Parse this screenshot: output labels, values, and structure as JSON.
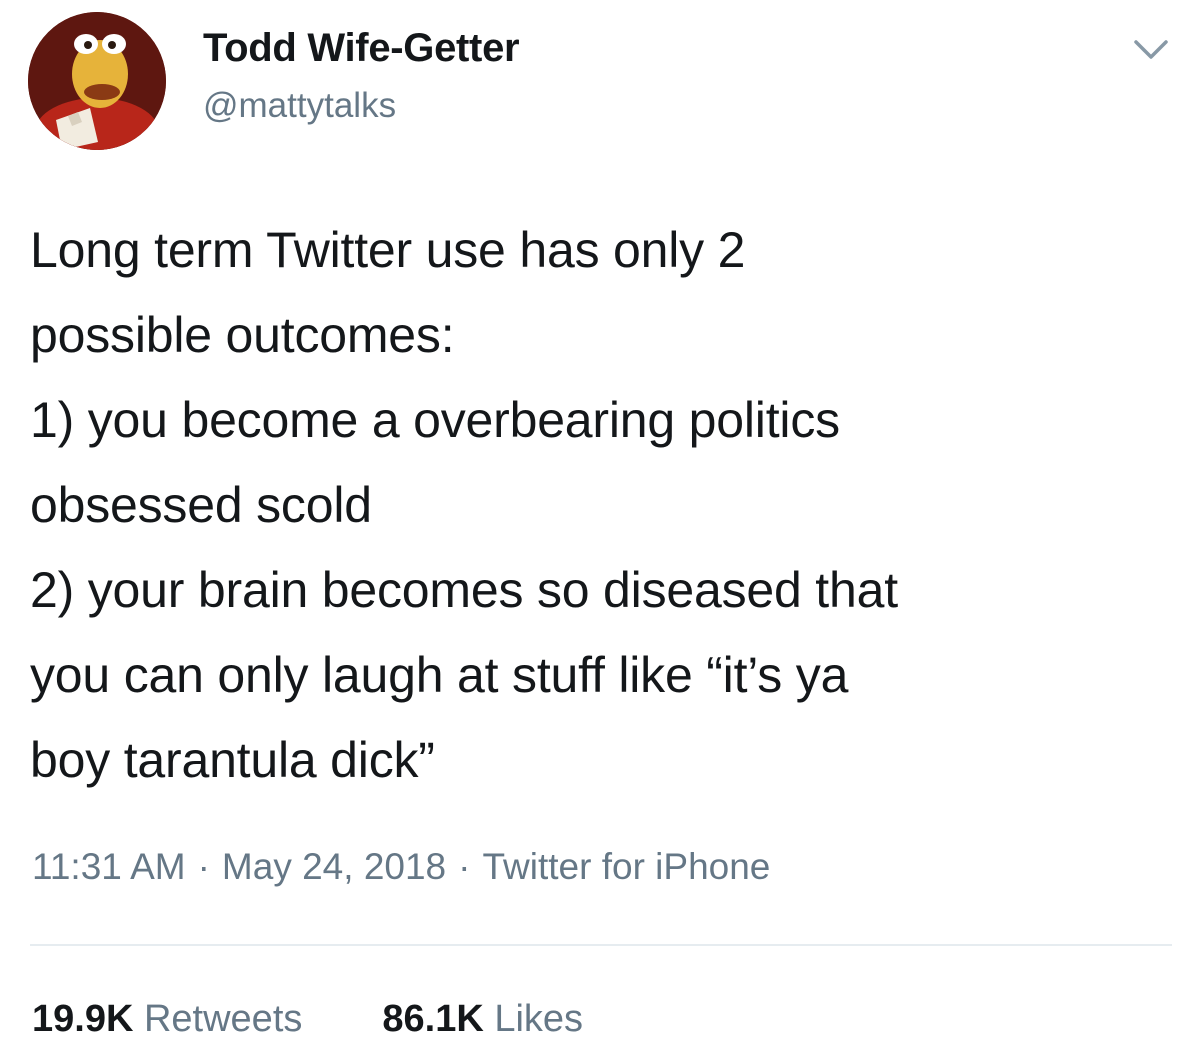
{
  "tweet": {
    "author": {
      "display_name": "Todd Wife-Getter",
      "handle": "@mattytalks"
    },
    "text": "Long term Twitter use has only 2\npossible outcomes:\n1) you become a overbearing politics\nobsessed scold\n2) your brain becomes so diseased that\nyou can only laugh at stuff like “it’s ya\nboy tarantula dick”",
    "time": "11:31 AM",
    "date": "May 24, 2018",
    "source": "Twitter for iPhone",
    "separator": "·",
    "stats": {
      "retweets_count": "19.9K",
      "retweets_label": "Retweets",
      "likes_count": "86.1K",
      "likes_label": "Likes"
    }
  },
  "icons": {
    "menu": "chevron-down-icon"
  },
  "colors": {
    "text": "#14171a",
    "secondary_text": "#657786",
    "divider": "#e6ecf0"
  }
}
